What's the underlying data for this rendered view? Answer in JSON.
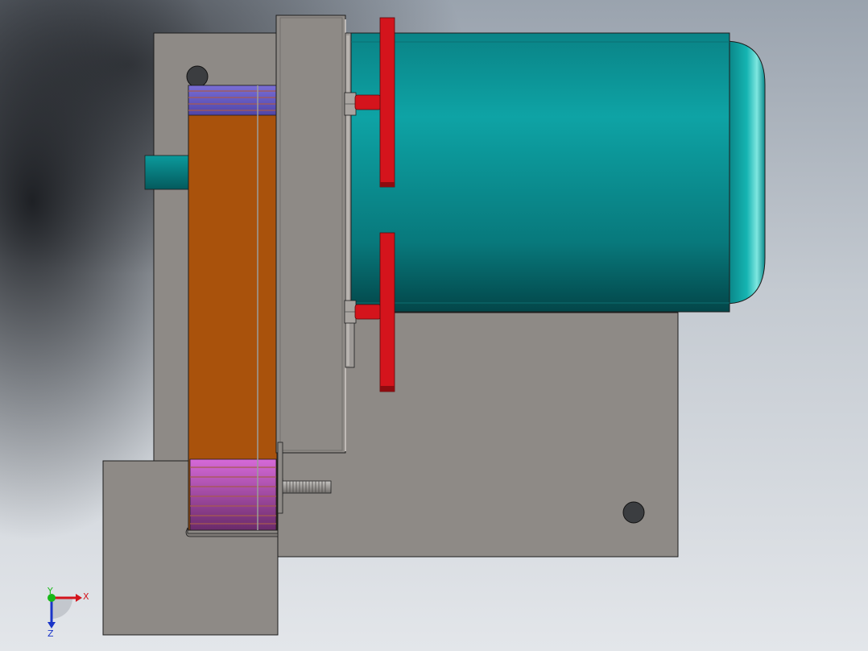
{
  "triad": {
    "x_label": "X",
    "y_label": "Y",
    "z_label": "Z",
    "x_color": "#d4141c",
    "y_color": "#18b818",
    "z_color": "#1a35c8"
  },
  "colors": {
    "plate": "#8e8a86",
    "motor": "#0b8f92",
    "motor_dark": "#05585b",
    "belt": "#a9520c",
    "pulley_top": "#6f63c8",
    "pulley_bottom": "#c258c8",
    "handle": "#d4141c",
    "shaft": "#0b8f92"
  }
}
